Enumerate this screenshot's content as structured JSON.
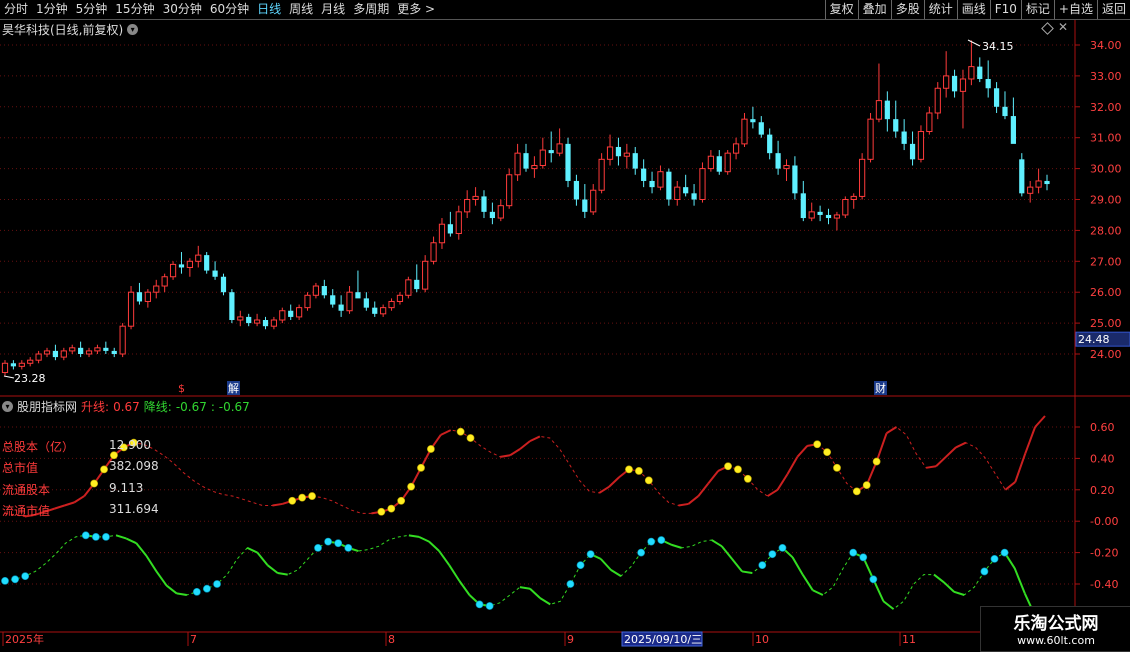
{
  "toolbar": {
    "periods": [
      "分时",
      "1分钟",
      "5分钟",
      "15分钟",
      "30分钟",
      "60分钟",
      "日线",
      "周线",
      "月线",
      "多周期",
      "更多 >"
    ],
    "active_period": "日线",
    "right_buttons": [
      "复权",
      "叠加",
      "多股",
      "统计",
      "画线",
      "F10",
      "+自选",
      "返回"
    ],
    "mark_label": "标记"
  },
  "stock": {
    "title": "昊华科技(日线,前复权)"
  },
  "price_axis": {
    "ticks": [
      "34.00",
      "33.00",
      "32.00",
      "31.00",
      "30.00",
      "29.00",
      "28.00",
      "27.00",
      "26.00",
      "25.00",
      "24.00"
    ],
    "current_label": "24.48",
    "high_label": "34.15",
    "low_label": "23.28"
  },
  "event_markers": {
    "s_mark": "$",
    "jie": "解",
    "cai": "财"
  },
  "indicator": {
    "name": "股朋指标网",
    "up_label": "升线:",
    "up_value": "0.67",
    "down_label": "降线:",
    "down_value": "-0.67",
    "down_value2": ": -0.67",
    "axis_ticks": [
      "0.60",
      "0.40",
      "0.20",
      "-0.00",
      "-0.20",
      "-0.40"
    ]
  },
  "info": [
    {
      "label": "总股本（亿）",
      "value": "12.900"
    },
    {
      "label": "总市值",
      "value": "382.098"
    },
    {
      "label": "流通股本",
      "value": "9.113"
    },
    {
      "label": "流通市值",
      "value": "311.694"
    }
  ],
  "date_axis": {
    "labels": [
      "2025年",
      "7",
      "8",
      "9",
      "10",
      "11"
    ],
    "selected_date": "2025/09/10/三"
  },
  "watermark": {
    "cn": "乐淘公式网",
    "url": "www.60lt.com"
  },
  "colors": {
    "up": "#ff3b3b",
    "down": "#5ff0ff",
    "up_line": "#cc2020",
    "down_line": "#33dd22",
    "yellow_dot": "#ffee22",
    "cyan_dot": "#22ddff",
    "accent": "#5fd7ff"
  },
  "chart_data": {
    "type": "candlestick",
    "y_range": [
      23.0,
      34.5
    ],
    "candles": [
      [
        23.4,
        23.8,
        23.3,
        23.7
      ],
      [
        23.7,
        23.8,
        23.5,
        23.6
      ],
      [
        23.6,
        23.8,
        23.5,
        23.7
      ],
      [
        23.7,
        23.9,
        23.6,
        23.8
      ],
      [
        23.8,
        24.1,
        23.7,
        24.0
      ],
      [
        24.0,
        24.2,
        23.9,
        24.1
      ],
      [
        24.1,
        24.3,
        23.8,
        23.9
      ],
      [
        23.9,
        24.2,
        23.8,
        24.1
      ],
      [
        24.1,
        24.3,
        24.0,
        24.2
      ],
      [
        24.2,
        24.4,
        23.9,
        24.0
      ],
      [
        24.0,
        24.2,
        23.9,
        24.1
      ],
      [
        24.1,
        24.3,
        24.0,
        24.2
      ],
      [
        24.2,
        24.4,
        24.0,
        24.1
      ],
      [
        24.1,
        24.2,
        23.9,
        24.0
      ],
      [
        24.0,
        25.0,
        23.9,
        24.9
      ],
      [
        24.9,
        26.2,
        24.8,
        26.0
      ],
      [
        26.0,
        26.3,
        25.6,
        25.7
      ],
      [
        25.7,
        26.1,
        25.5,
        26.0
      ],
      [
        26.0,
        26.4,
        25.8,
        26.2
      ],
      [
        26.2,
        26.6,
        26.0,
        26.5
      ],
      [
        26.5,
        27.0,
        26.4,
        26.9
      ],
      [
        26.9,
        27.3,
        26.6,
        26.8
      ],
      [
        26.8,
        27.1,
        26.5,
        27.0
      ],
      [
        27.0,
        27.5,
        26.8,
        27.2
      ],
      [
        27.2,
        27.3,
        26.6,
        26.7
      ],
      [
        26.7,
        27.0,
        26.4,
        26.5
      ],
      [
        26.5,
        26.6,
        25.9,
        26.0
      ],
      [
        26.0,
        26.1,
        25.0,
        25.1
      ],
      [
        25.1,
        25.4,
        24.9,
        25.2
      ],
      [
        25.2,
        25.3,
        24.9,
        25.0
      ],
      [
        25.0,
        25.3,
        24.9,
        25.1
      ],
      [
        25.1,
        25.2,
        24.8,
        24.9
      ],
      [
        24.9,
        25.2,
        24.8,
        25.1
      ],
      [
        25.1,
        25.5,
        25.0,
        25.4
      ],
      [
        25.4,
        25.6,
        25.1,
        25.2
      ],
      [
        25.2,
        25.6,
        25.1,
        25.5
      ],
      [
        25.5,
        26.0,
        25.4,
        25.9
      ],
      [
        25.9,
        26.3,
        25.8,
        26.2
      ],
      [
        26.2,
        26.4,
        25.8,
        25.9
      ],
      [
        25.9,
        26.1,
        25.5,
        25.6
      ],
      [
        25.6,
        25.9,
        25.2,
        25.4
      ],
      [
        25.4,
        26.2,
        25.3,
        26.0
      ],
      [
        26.0,
        26.7,
        25.9,
        25.8
      ],
      [
        25.8,
        26.0,
        25.4,
        25.5
      ],
      [
        25.5,
        25.7,
        25.2,
        25.3
      ],
      [
        25.3,
        25.6,
        25.2,
        25.5
      ],
      [
        25.5,
        25.8,
        25.4,
        25.7
      ],
      [
        25.7,
        26.0,
        25.6,
        25.9
      ],
      [
        25.9,
        26.5,
        25.8,
        26.4
      ],
      [
        26.4,
        26.9,
        26.0,
        26.1
      ],
      [
        26.1,
        27.2,
        26.0,
        27.0
      ],
      [
        27.0,
        27.8,
        26.9,
        27.6
      ],
      [
        27.6,
        28.4,
        27.4,
        28.2
      ],
      [
        28.2,
        28.6,
        27.8,
        27.9
      ],
      [
        27.9,
        28.8,
        27.7,
        28.6
      ],
      [
        28.6,
        29.3,
        28.4,
        29.0
      ],
      [
        29.0,
        29.4,
        28.8,
        29.1
      ],
      [
        29.1,
        29.3,
        28.4,
        28.6
      ],
      [
        28.6,
        28.9,
        28.2,
        28.4
      ],
      [
        28.4,
        29.0,
        28.3,
        28.8
      ],
      [
        28.8,
        30.0,
        28.7,
        29.8
      ],
      [
        29.8,
        30.8,
        29.6,
        30.5
      ],
      [
        30.5,
        30.8,
        29.9,
        30.0
      ],
      [
        30.0,
        30.4,
        29.7,
        30.1
      ],
      [
        30.1,
        31.0,
        30.0,
        30.6
      ],
      [
        30.6,
        31.2,
        30.2,
        30.5
      ],
      [
        30.5,
        31.3,
        30.4,
        30.8
      ],
      [
        30.8,
        31.0,
        29.4,
        29.6
      ],
      [
        29.6,
        29.8,
        28.8,
        29.0
      ],
      [
        29.0,
        29.5,
        28.4,
        28.6
      ],
      [
        28.6,
        29.5,
        28.5,
        29.3
      ],
      [
        29.3,
        30.5,
        29.2,
        30.3
      ],
      [
        30.3,
        31.1,
        30.1,
        30.7
      ],
      [
        30.7,
        31.0,
        30.1,
        30.4
      ],
      [
        30.4,
        30.8,
        30.0,
        30.5
      ],
      [
        30.5,
        30.7,
        29.8,
        30.0
      ],
      [
        30.0,
        30.3,
        29.4,
        29.6
      ],
      [
        29.6,
        29.9,
        29.2,
        29.4
      ],
      [
        29.4,
        30.1,
        29.3,
        29.9
      ],
      [
        29.9,
        30.0,
        28.8,
        29.0
      ],
      [
        29.0,
        29.6,
        28.8,
        29.4
      ],
      [
        29.4,
        29.8,
        29.1,
        29.2
      ],
      [
        29.2,
        29.5,
        28.8,
        29.0
      ],
      [
        29.0,
        30.2,
        28.9,
        30.0
      ],
      [
        30.0,
        30.6,
        29.9,
        30.4
      ],
      [
        30.4,
        30.6,
        29.8,
        29.9
      ],
      [
        29.9,
        30.6,
        29.8,
        30.5
      ],
      [
        30.5,
        31.0,
        30.3,
        30.8
      ],
      [
        30.8,
        31.8,
        30.7,
        31.6
      ],
      [
        31.6,
        32.0,
        31.3,
        31.5
      ],
      [
        31.5,
        31.7,
        31.0,
        31.1
      ],
      [
        31.1,
        31.3,
        30.3,
        30.5
      ],
      [
        30.5,
        30.9,
        29.8,
        30.0
      ],
      [
        30.0,
        30.3,
        29.6,
        30.1
      ],
      [
        30.1,
        30.4,
        29.0,
        29.2
      ],
      [
        29.2,
        29.6,
        28.3,
        28.4
      ],
      [
        28.4,
        28.9,
        28.3,
        28.6
      ],
      [
        28.6,
        28.8,
        28.3,
        28.5
      ],
      [
        28.5,
        28.7,
        28.2,
        28.4
      ],
      [
        28.4,
        28.6,
        28.0,
        28.5
      ],
      [
        28.5,
        29.1,
        28.4,
        29.0
      ],
      [
        29.0,
        29.2,
        28.7,
        29.1
      ],
      [
        29.1,
        30.5,
        29.0,
        30.3
      ],
      [
        30.3,
        31.8,
        30.2,
        31.6
      ],
      [
        31.6,
        33.4,
        31.5,
        32.2
      ],
      [
        32.2,
        32.5,
        31.2,
        31.6
      ],
      [
        31.6,
        32.2,
        31.0,
        31.2
      ],
      [
        31.2,
        31.6,
        30.6,
        30.8
      ],
      [
        30.8,
        31.2,
        30.1,
        30.3
      ],
      [
        30.3,
        31.4,
        30.2,
        31.2
      ],
      [
        31.2,
        32.0,
        31.1,
        31.8
      ],
      [
        31.8,
        32.8,
        31.6,
        32.6
      ],
      [
        32.6,
        33.8,
        32.3,
        33.0
      ],
      [
        33.0,
        33.2,
        32.3,
        32.5
      ],
      [
        32.5,
        33.2,
        31.3,
        32.9
      ],
      [
        32.9,
        34.15,
        32.7,
        33.3
      ],
      [
        33.3,
        33.6,
        32.8,
        32.9
      ],
      [
        32.9,
        33.5,
        32.3,
        32.6
      ],
      [
        32.6,
        32.8,
        31.8,
        32.0
      ],
      [
        32.0,
        32.5,
        31.6,
        31.7
      ],
      [
        31.7,
        32.3,
        30.9,
        30.8
      ],
      [
        30.3,
        30.5,
        29.1,
        29.2
      ],
      [
        29.2,
        29.6,
        28.9,
        29.4
      ],
      [
        29.4,
        30.0,
        29.2,
        29.6
      ],
      [
        29.6,
        29.8,
        29.3,
        29.5
      ]
    ],
    "indicator_up": [
      0.05,
      0.04,
      0.03,
      0.04,
      0.06,
      0.08,
      0.1,
      0.12,
      0.16,
      0.24,
      0.33,
      0.42,
      0.47,
      0.5,
      0.49,
      0.46,
      0.42,
      0.37,
      0.31,
      0.26,
      0.22,
      0.19,
      0.17,
      0.16,
      0.14,
      0.12,
      0.1,
      0.1,
      0.11,
      0.13,
      0.15,
      0.16,
      0.15,
      0.13,
      0.1,
      0.07,
      0.05,
      0.05,
      0.06,
      0.08,
      0.13,
      0.22,
      0.34,
      0.46,
      0.55,
      0.58,
      0.57,
      0.53,
      0.48,
      0.44,
      0.41,
      0.42,
      0.46,
      0.51,
      0.54,
      0.53,
      0.46,
      0.36,
      0.26,
      0.19,
      0.18,
      0.22,
      0.28,
      0.33,
      0.32,
      0.26,
      0.18,
      0.12,
      0.1,
      0.11,
      0.16,
      0.24,
      0.32,
      0.35,
      0.33,
      0.27,
      0.2,
      0.16,
      0.2,
      0.3,
      0.41,
      0.48,
      0.49,
      0.44,
      0.34,
      0.24,
      0.19,
      0.23,
      0.38,
      0.56,
      0.6,
      0.55,
      0.43,
      0.34,
      0.35,
      0.41,
      0.47,
      0.5,
      0.47,
      0.4,
      0.3,
      0.2,
      0.25,
      0.43,
      0.6,
      0.67
    ],
    "indicator_down": [
      -0.38,
      -0.37,
      -0.35,
      -0.32,
      -0.27,
      -0.21,
      -0.14,
      -0.1,
      -0.09,
      -0.1,
      -0.1,
      -0.09,
      -0.11,
      -0.14,
      -0.22,
      -0.32,
      -0.41,
      -0.46,
      -0.47,
      -0.45,
      -0.43,
      -0.4,
      -0.34,
      -0.24,
      -0.17,
      -0.2,
      -0.28,
      -0.33,
      -0.34,
      -0.31,
      -0.24,
      -0.17,
      -0.13,
      -0.14,
      -0.17,
      -0.19,
      -0.18,
      -0.16,
      -0.12,
      -0.1,
      -0.09,
      -0.1,
      -0.13,
      -0.19,
      -0.28,
      -0.38,
      -0.47,
      -0.53,
      -0.54,
      -0.52,
      -0.47,
      -0.42,
      -0.43,
      -0.49,
      -0.53,
      -0.51,
      -0.4,
      -0.28,
      -0.21,
      -0.24,
      -0.31,
      -0.35,
      -0.29,
      -0.2,
      -0.13,
      -0.12,
      -0.15,
      -0.17,
      -0.16,
      -0.13,
      -0.12,
      -0.16,
      -0.24,
      -0.32,
      -0.33,
      -0.28,
      -0.21,
      -0.17,
      -0.23,
      -0.34,
      -0.44,
      -0.47,
      -0.42,
      -0.3,
      -0.2,
      -0.23,
      -0.37,
      -0.51,
      -0.56,
      -0.51,
      -0.4,
      -0.34,
      -0.34,
      -0.39,
      -0.45,
      -0.47,
      -0.42,
      -0.32,
      -0.24,
      -0.2,
      -0.3,
      -0.46,
      -0.6,
      -0.67
    ],
    "up_dot_segments": [
      [
        9,
        13
      ],
      [
        29,
        31
      ],
      [
        38,
        43
      ],
      [
        46,
        47
      ],
      [
        63,
        65
      ],
      [
        73,
        75
      ],
      [
        82,
        84
      ],
      [
        86,
        88
      ]
    ],
    "down_dot_segments": [
      [
        0,
        2
      ],
      [
        8,
        10
      ],
      [
        19,
        21
      ],
      [
        31,
        34
      ],
      [
        47,
        48
      ],
      [
        56,
        58
      ],
      [
        63,
        65
      ],
      [
        75,
        77
      ],
      [
        84,
        86
      ],
      [
        97,
        99
      ]
    ]
  }
}
